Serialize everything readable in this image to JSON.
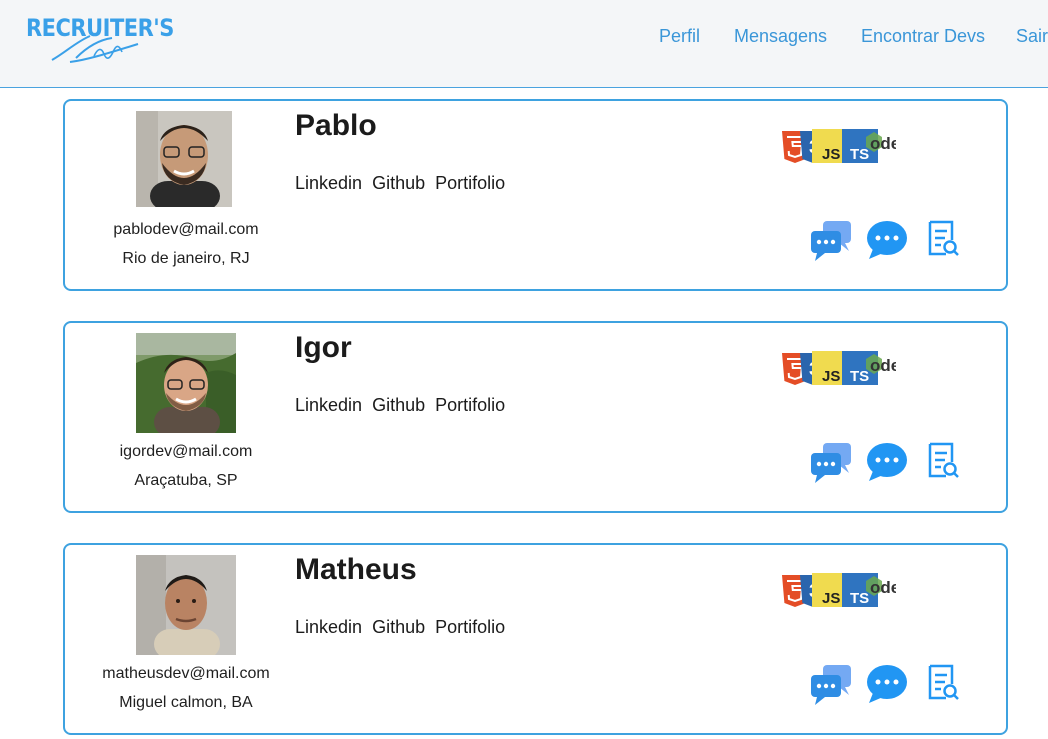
{
  "logo": {
    "text": "RECRUITER'S",
    "script": "Place"
  },
  "nav": [
    {
      "label": "Perfil"
    },
    {
      "label": "Mensagens"
    },
    {
      "label": "Encontrar Devs"
    },
    {
      "label": "Sair"
    }
  ],
  "colors": {
    "accent": "#3ea2e0",
    "header_bg": "#f4f6f8",
    "icon_blue": "#2f8de4"
  },
  "link_labels": [
    "Linkedin",
    "Github",
    "Portifolio"
  ],
  "tech_icons": [
    "html5-icon",
    "css3-icon",
    "javascript-icon",
    "typescript-icon",
    "nodejs-icon"
  ],
  "tech_texts": {
    "css": "3",
    "js": "JS",
    "ts": "TS",
    "node": "ode"
  },
  "action_icons": [
    "chat-bubbles-icon",
    "message-icon",
    "resume-search-icon"
  ],
  "devs": [
    {
      "name": "Pablo",
      "email": "pablodev@mail.com",
      "location": "Rio de janeiro, RJ"
    },
    {
      "name": "Igor",
      "email": "igordev@mail.com",
      "location": "Araçatuba, SP"
    },
    {
      "name": "Matheus",
      "email": "matheusdev@mail.com",
      "location": "Miguel calmon, BA"
    }
  ]
}
